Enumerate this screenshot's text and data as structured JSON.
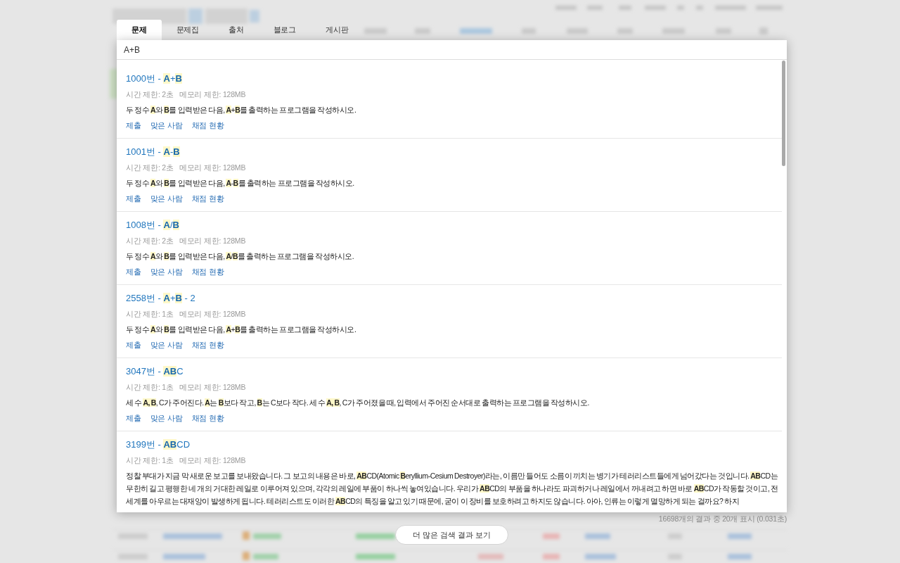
{
  "tabs": [
    {
      "label": "문제",
      "selected": true
    },
    {
      "label": "문제집",
      "selected": false
    },
    {
      "label": "출처",
      "selected": false
    },
    {
      "label": "블로그",
      "selected": false
    },
    {
      "label": "게시판",
      "selected": false
    }
  ],
  "search": {
    "value": "A+B"
  },
  "results": [
    {
      "title": "1000번 - **A**+**B**",
      "time_limit": "시간 제한: 2초",
      "memory_limit": "메모리 제한: 128MB",
      "description": "두 정수 **A**와 **B**를 입력받은 다음, **A**+**B**를 출력하는 프로그램을 작성하시오.",
      "links": [
        "제출",
        "맞은 사람",
        "채점 현황"
      ]
    },
    {
      "title": "1001번 - **A**-**B**",
      "time_limit": "시간 제한: 2초",
      "memory_limit": "메모리 제한: 128MB",
      "description": "두 정수 **A**와 **B**를 입력받은 다음, **A**-**B**를 출력하는 프로그램을 작성하시오.",
      "links": [
        "제출",
        "맞은 사람",
        "채점 현황"
      ]
    },
    {
      "title": "1008번 - **A**/**B**",
      "time_limit": "시간 제한: 2초",
      "memory_limit": "메모리 제한: 128MB",
      "description": "두 정수 **A**와 **B**를 입력받은 다음, **A**/**B**를 출력하는 프로그램을 작성하시오.",
      "links": [
        "제출",
        "맞은 사람",
        "채점 현황"
      ]
    },
    {
      "title": "2558번 - **A**+**B** - 2",
      "time_limit": "시간 제한: 1초",
      "memory_limit": "메모리 제한: 128MB",
      "description": "두 정수 **A**와 **B**를 입력받은 다음, **A**+**B**를 출력하는 프로그램을 작성하시오.",
      "links": [
        "제출",
        "맞은 사람",
        "채점 현황"
      ]
    },
    {
      "title": "3047번 - **AB**C",
      "time_limit": "시간 제한: 1초",
      "memory_limit": "메모리 제한: 128MB",
      "description": "세 수 **A, B**, C가 주어진다. **A**는 **B**보다 작고, **B**는 C보다 작다. 세 수 **A, B**, C가 주어졌을 때, 입력에서 주어진 순서대로 출력하는 프로그램을 작성하시오.",
      "links": [
        "제출",
        "맞은 사람",
        "채점 현황"
      ]
    },
    {
      "title": "3199번 - **AB**CD",
      "time_limit": "시간 제한: 1초",
      "memory_limit": "메모리 제한: 128MB",
      "description": "정찰 부대가 지금 막 새로운 보고를 보내왔습니다. 그 보고의 내용은 바로, **AB**CD(Atomic **B**eryllium-Cesium Destroyer)라는, 이름만 들어도 소름이 끼치는 병기가 테러리스트들에게 넘어갔다는 것입니다. **AB**CD는 무한히 길고 평행한 네 개의 거대한 레일로 이루어져 있으며, 각각의 레일에 부품이 하나씩 놓여있습니다. 우리가 **AB**CD의 부품을 하나라도 파괴하거나 레일에서 꺼내려고 하면 바로 **AB**CD가 작동할 것이고, 전세계를 아우르는 대재앙이 발생하게 됩니다. 테러리스트도 이러한 **AB**CD의 특징을 알고 있기 때문에, 굳이 이 장비를 보호하려고 하지도 않습니다. 아아, 인류는 이렇게 멸망하게 되는 걸까요? 하지"
    }
  ],
  "result_count": "16698개의 결과 중 20개 표시 (0.031초)",
  "more_button": "더 많은 검색 결과 보기"
}
